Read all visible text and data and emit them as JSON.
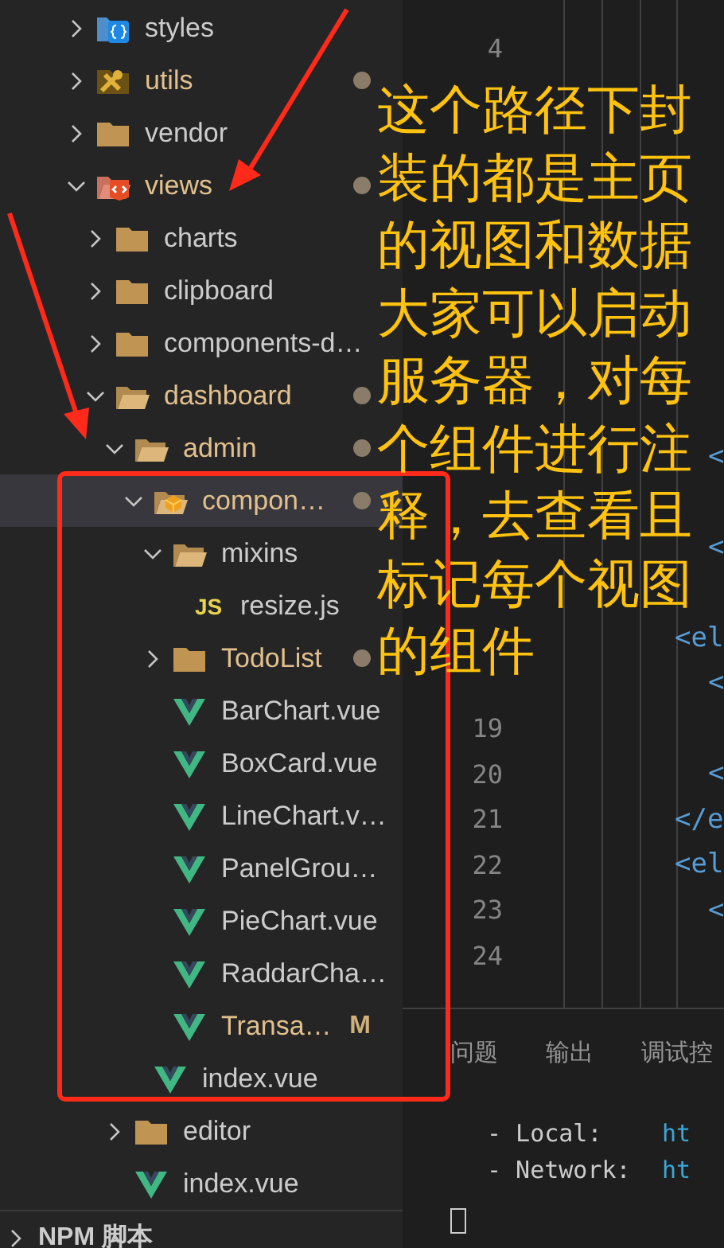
{
  "explorer": {
    "tree": [
      {
        "name": "styles",
        "kind": "styles",
        "expanded": false,
        "modified": false,
        "selected": false
      },
      {
        "name": "utils",
        "kind": "tools",
        "expanded": false,
        "modified": true,
        "selected": false
      },
      {
        "name": "vendor",
        "kind": "folder",
        "expanded": false,
        "modified": false,
        "selected": false
      },
      {
        "name": "views",
        "kind": "views",
        "expanded": true,
        "modified": true,
        "selected": false,
        "children": [
          {
            "name": "charts",
            "kind": "folder",
            "expanded": false,
            "modified": false,
            "selected": false
          },
          {
            "name": "clipboard",
            "kind": "folder",
            "expanded": false,
            "modified": false,
            "selected": false
          },
          {
            "name": "components-d…",
            "kind": "folder",
            "expanded": false,
            "modified": false,
            "selected": false
          },
          {
            "name": "dashboard",
            "kind": "folder",
            "expanded": true,
            "modified": true,
            "selected": false,
            "children": [
              {
                "name": "admin",
                "kind": "folder",
                "expanded": true,
                "modified": true,
                "selected": false,
                "children": [
                  {
                    "name": "compon…",
                    "kind": "components",
                    "expanded": true,
                    "modified": true,
                    "selected": true,
                    "children": [
                      {
                        "name": "mixins",
                        "kind": "folder",
                        "expanded": true,
                        "modified": false,
                        "selected": false,
                        "children": [
                          {
                            "name": "resize.js",
                            "kind": "js",
                            "icon_text": "JS",
                            "modified": false,
                            "selected": false
                          }
                        ]
                      },
                      {
                        "name": "TodoList",
                        "kind": "folder",
                        "expanded": false,
                        "modified": true,
                        "selected": false
                      },
                      {
                        "name": "BarChart.vue",
                        "kind": "vue",
                        "modified": false,
                        "selected": false
                      },
                      {
                        "name": "BoxCard.vue",
                        "kind": "vue",
                        "modified": false,
                        "selected": false
                      },
                      {
                        "name": "LineChart.v…",
                        "kind": "vue",
                        "modified": false,
                        "selected": false
                      },
                      {
                        "name": "PanelGrou…",
                        "kind": "vue",
                        "modified": false,
                        "selected": false
                      },
                      {
                        "name": "PieChart.vue",
                        "kind": "vue",
                        "modified": false,
                        "selected": false
                      },
                      {
                        "name": "RaddarCha…",
                        "kind": "vue",
                        "modified": false,
                        "selected": false
                      },
                      {
                        "name": "Transa…",
                        "kind": "vue",
                        "modified": true,
                        "badge": "M",
                        "selected": false
                      }
                    ]
                  },
                  {
                    "name": "index.vue",
                    "kind": "vue",
                    "modified": false,
                    "selected": false
                  }
                ]
              },
              {
                "name": "editor",
                "kind": "folder",
                "expanded": false,
                "modified": false,
                "selected": false
              },
              {
                "name": "index.vue",
                "kind": "vue",
                "modified": false,
                "selected": false
              }
            ]
          }
        ]
      }
    ],
    "section": {
      "title": "NPM 脚本",
      "expanded": false
    }
  },
  "editor": {
    "lines": [
      {
        "number": "4",
        "kind": "plain"
      },
      {
        "kind": "covered"
      },
      {
        "kind": "covered"
      },
      {
        "kind": "covered"
      },
      {
        "kind": "covered"
      },
      {
        "kind": "covered"
      },
      {
        "kind": "covered"
      },
      {
        "kind": "covered"
      },
      {
        "kind": "covered"
      },
      {
        "code": "<",
        "kind": "deep"
      },
      {
        "kind": "covered"
      },
      {
        "code": "<",
        "kind": "deep"
      },
      {
        "kind": "covered"
      },
      {
        "code": "<el",
        "kind": "inner"
      },
      {
        "code": "<",
        "kind": "deep"
      },
      {
        "number": "19",
        "kind": "plain"
      },
      {
        "number": "20",
        "code": "<",
        "kind": "deep"
      },
      {
        "number": "21",
        "code": "</e",
        "kind": "inner"
      },
      {
        "number": "22",
        "code": "<el",
        "kind": "inner"
      },
      {
        "number": "23",
        "code": "<",
        "kind": "deep"
      },
      {
        "number": "24",
        "kind": "plain"
      }
    ]
  },
  "panel": {
    "tabs": [
      {
        "label": "问题",
        "selected": false
      },
      {
        "label": "输出",
        "selected": false
      },
      {
        "label": "调试控",
        "selected": false
      }
    ],
    "terminal": [
      {
        "label": "- Local:",
        "link": "ht"
      },
      {
        "label": "- Network:",
        "link": "ht"
      }
    ]
  },
  "annotation": {
    "lines": [
      "这个路径下封",
      "装的都是主页",
      "的视图和数据",
      "大家可以启动",
      "服务器，对每",
      "个组件进行注",
      "释，去查看且",
      "标记每个视图",
      "的组件"
    ]
  }
}
